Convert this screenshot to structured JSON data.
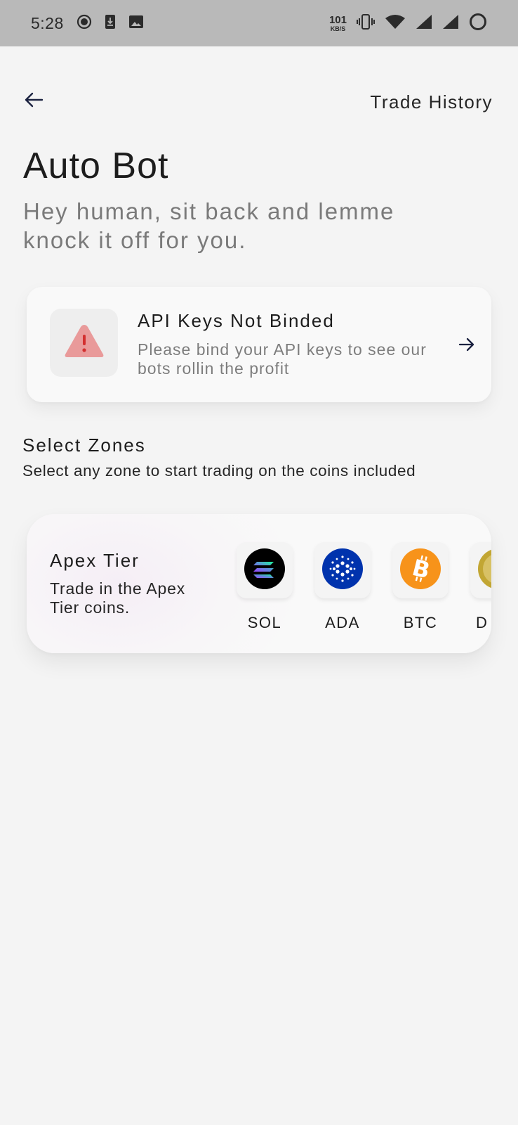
{
  "status_bar": {
    "time": "5:28",
    "net_speed_value": "101",
    "net_speed_unit": "KB/S",
    "icons": [
      "record-icon",
      "download-icon",
      "image-icon",
      "vibrate-icon",
      "wifi-icon",
      "signal-icon",
      "signal-icon",
      "battery-ring-icon"
    ]
  },
  "header": {
    "back_icon": "arrow-left-icon",
    "trade_history_label": "Trade History"
  },
  "page": {
    "title": "Auto Bot",
    "subtitle": "Hey human, sit back and lemme knock it off for you."
  },
  "api_card": {
    "icon": "warning-icon",
    "title": "API Keys Not Binded",
    "description": "Please bind your API keys to see our bots rollin the profit",
    "arrow_icon": "arrow-right-icon"
  },
  "zones": {
    "title": "Select Zones",
    "subtitle": "Select any zone to start trading on the coins included",
    "items": [
      {
        "name": "Apex Tier",
        "description": "Trade in the Apex Tier coins.",
        "coins": [
          {
            "label": "SOL",
            "icon": "solana-icon",
            "color": "#000000"
          },
          {
            "label": "ADA",
            "icon": "cardano-icon",
            "color": "#0033ad"
          },
          {
            "label": "BTC",
            "icon": "bitcoin-icon",
            "color": "#f7931a"
          },
          {
            "label": "D",
            "icon": "dogecoin-icon",
            "color": "#c2a633"
          }
        ]
      }
    ]
  },
  "colors": {
    "background": "#f4f4f4",
    "status_bar": "#b9b9b9",
    "warning": "#e57373",
    "subtitle_gray": "#7a7a7a"
  }
}
